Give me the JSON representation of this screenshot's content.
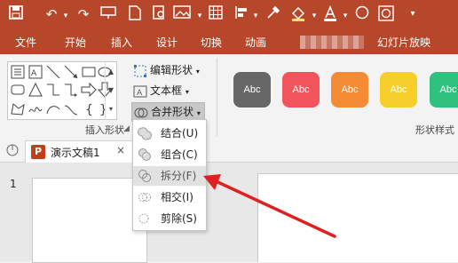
{
  "colors": {
    "accent": "#b7472a",
    "highlight": "#e1e1e1",
    "arrow": "#e02020"
  },
  "quick_access": [
    "save-icon",
    "undo-icon",
    "redo-icon",
    "slideshow-icon",
    "new-file-icon",
    "print-preview-icon",
    "image-icon",
    "grid-icon",
    "align-icon",
    "eyedropper-icon",
    "fill-icon",
    "font-color-icon",
    "circle-icon",
    "merge-shapes-icon"
  ],
  "menu_tabs": {
    "file": "文件",
    "home": "开始",
    "insert": "插入",
    "design": "设计",
    "transitions": "切换",
    "animations": "动画",
    "slideshow": "幻灯片放映"
  },
  "ribbon": {
    "edit_shape": "编辑形状",
    "text_box": "文本框",
    "merge_shapes": "合并形状",
    "group_insert_shapes": "插入形状",
    "group_shape_styles": "形状样式",
    "style_samples": [
      {
        "label": "Abc",
        "color": "#666666"
      },
      {
        "label": "Abc",
        "color": "#f2545b"
      },
      {
        "label": "Abc",
        "color": "#f58b35"
      },
      {
        "label": "Abc",
        "color": "#f7cf2b"
      },
      {
        "label": "Abc",
        "color": "#2ec27e"
      }
    ]
  },
  "dropdown": {
    "items": [
      {
        "label": "结合(U)",
        "icon": "union-icon"
      },
      {
        "label": "组合(C)",
        "icon": "combine-icon"
      },
      {
        "label": "拆分(F)",
        "icon": "fragment-icon"
      },
      {
        "label": "相交(I)",
        "icon": "intersect-icon"
      },
      {
        "label": "剪除(S)",
        "icon": "subtract-icon"
      }
    ],
    "highlighted_index": 2
  },
  "document": {
    "tab_title": "演示文稿1",
    "slide_number": "1"
  }
}
